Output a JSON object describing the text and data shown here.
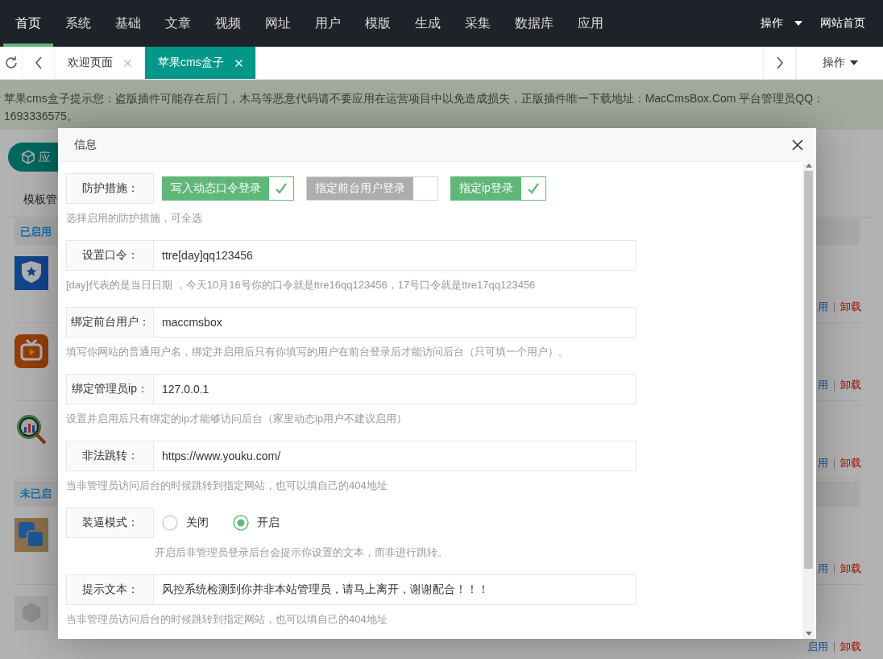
{
  "top_nav": {
    "items": [
      {
        "label": "首页",
        "selected": true
      },
      {
        "label": "系统",
        "selected": false
      },
      {
        "label": "基础",
        "selected": false
      },
      {
        "label": "文章",
        "selected": false
      },
      {
        "label": "视频",
        "selected": false
      },
      {
        "label": "网址",
        "selected": false
      },
      {
        "label": "用户",
        "selected": false
      },
      {
        "label": "模版",
        "selected": false
      },
      {
        "label": "生成",
        "selected": false
      },
      {
        "label": "采集",
        "selected": false
      },
      {
        "label": "数据库",
        "selected": false
      },
      {
        "label": "应用",
        "selected": false
      }
    ],
    "actions": [
      {
        "label": "操作",
        "kind": "dropdown"
      },
      {
        "label": "网站首页",
        "kind": "link"
      }
    ]
  },
  "tab_bar": {
    "tabs": [
      {
        "label": "欢迎页面",
        "selected": false
      },
      {
        "label": "苹果cms盒子",
        "selected": true
      }
    ],
    "menu_label": "操作"
  },
  "notice": "苹果cms盒子提示您：盗版插件可能存在后门，木马等恶意代码请不要应用在运营项目中以免造成损失，正版插件唯一下载地址：MacCmsBox.Com 平台管理员QQ：1693336575。",
  "page": {
    "app_button": "应",
    "tab": "模板管",
    "sections": [
      {
        "title": "已启用",
        "rows": [
          {
            "kind": "shield",
            "actions": [
              {
                "label": "用",
                "kind": "toggle"
              },
              {
                "label": "卸载",
                "kind": "uninstall"
              }
            ]
          },
          {
            "kind": "tv",
            "actions": [
              {
                "label": "用",
                "kind": "toggle"
              },
              {
                "label": "卸载",
                "kind": "uninstall"
              }
            ]
          },
          {
            "kind": "chart",
            "actions": [
              {
                "label": "用",
                "kind": "toggle"
              },
              {
                "label": "卸载",
                "kind": "uninstall"
              }
            ]
          }
        ]
      },
      {
        "title": "未已启",
        "rows": [
          {
            "kind": "squares",
            "actions": [
              {
                "label": "用",
                "kind": "toggle"
              },
              {
                "label": "卸载",
                "kind": "uninstall"
              }
            ]
          },
          {
            "kind": "cube",
            "actions": [
              {
                "label": "启用",
                "kind": "toggle"
              },
              {
                "label": "卸载",
                "kind": "uninstall"
              }
            ]
          }
        ]
      }
    ]
  },
  "modal": {
    "title": "信息",
    "fields": [
      {
        "kind": "checks",
        "label": "防护措施：",
        "options": [
          {
            "label": "写入动态口令登录",
            "checked": true
          },
          {
            "label": "指定前台用户登录",
            "checked": false
          },
          {
            "label": "指定ip登录",
            "checked": true
          }
        ],
        "help": "选择启用的防护措施，可全选"
      },
      {
        "kind": "text",
        "label": "设置口令：",
        "value": "ttre[day]qq123456",
        "help": "[day]代表的是当日日期 ，今天10月16号你的口令就是ttre16qq123456，17号口令就是ttre17qq123456"
      },
      {
        "kind": "text",
        "label": "绑定前台用户：",
        "value": "maccmsbox",
        "help": "填写你网站的普通用户名，绑定并启用后只有你填写的用户在前台登录后才能访问后台（只可填一个用户）。"
      },
      {
        "kind": "text",
        "label": "绑定管理员ip：",
        "value": "127.0.0.1",
        "help": "设置并启用后只有绑定的ip才能够访问后台（家里动态ip用户不建议启用）"
      },
      {
        "kind": "text",
        "label": "非法跳转：",
        "value": "https://www.youku.com/",
        "help": "当非管理员访问后台的时候跳转到指定网站，也可以填自己的404地址"
      },
      {
        "kind": "radio",
        "label": "装逼模式：",
        "options": [
          {
            "label": "关闭",
            "selected": false
          },
          {
            "label": "开启",
            "selected": true
          }
        ],
        "help": "开启后非管理员登录后台会提示你设置的文本，而非进行跳转。"
      },
      {
        "kind": "text",
        "label": "提示文本：",
        "value": "风控系统检测到你并非本站管理员，请马上离开，谢谢配合！！！",
        "help": "当非管理员访问后台的时候跳转到指定网站，也可以填自己的404地址"
      }
    ]
  }
}
